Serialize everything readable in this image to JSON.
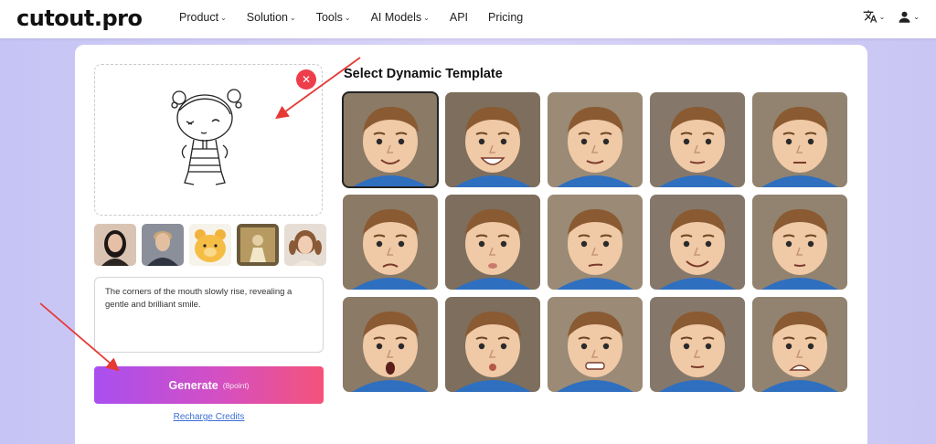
{
  "header": {
    "logo": "cutout.pro",
    "nav": [
      {
        "label": "Product",
        "has_caret": true
      },
      {
        "label": "Solution",
        "has_caret": true
      },
      {
        "label": "Tools",
        "has_caret": true
      },
      {
        "label": "AI Models",
        "has_caret": true
      },
      {
        "label": "API",
        "has_caret": false
      },
      {
        "label": "Pricing",
        "has_caret": false
      }
    ],
    "right_icons": [
      "translate-icon",
      "user-icon"
    ]
  },
  "editor": {
    "uploaded_image": "chibi-girl-line-sketch",
    "close_icon": "close-icon",
    "sample_thumbs": [
      "woman-portrait",
      "man-portrait",
      "bear-toy",
      "girl-vintage",
      "girl-pigtails"
    ],
    "prompt_text": "The corners of the mouth slowly rise, revealing a gentle and brilliant smile.",
    "generate_label": "Generate",
    "generate_points": "(8point)",
    "recharge_label": "Recharge Credits"
  },
  "templates": {
    "title": "Select Dynamic Template",
    "selected_index": 0,
    "items": [
      "smile-closed",
      "big-grin",
      "soft-smile",
      "neutral-smile",
      "neutral",
      "frown",
      "pout-sad",
      "skeptical",
      "squint-grin",
      "side-glance",
      "surprised-o",
      "kiss-pout",
      "gritted-grin",
      "calm",
      "crying"
    ]
  },
  "colors": {
    "accent_red": "#ee3d4b",
    "gen_gradient_start": "#a94ff0",
    "gen_gradient_end": "#f4537a",
    "link_blue": "#3d6fd8",
    "annotation_red": "#e53935"
  }
}
